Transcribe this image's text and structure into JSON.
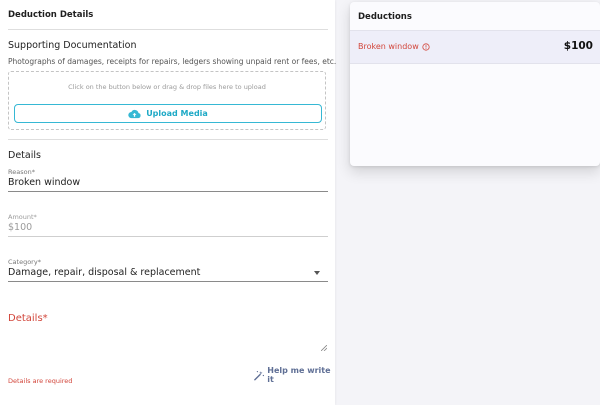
{
  "left_panel": {
    "title": "Deduction Details",
    "supporting": {
      "title": "Supporting Documentation",
      "hint": "Photographs of damages, receipts for repairs, ledgers showing unpaid rent or fees, etc.",
      "drop_hint": "Click on the button below or drag & drop files here to upload",
      "upload_label": "Upload Media",
      "upload_icon": "cloud-upload-icon"
    },
    "details_section_title": "Details",
    "reason": {
      "label": "Reason*",
      "value": "Broken window"
    },
    "amount": {
      "label": "Amount*",
      "prefix": "$",
      "value": "100"
    },
    "category": {
      "label": "Category*",
      "value": "Damage, repair, disposal & replacement"
    },
    "details_field": {
      "label": "Details*",
      "value": "",
      "error": "Details are required"
    },
    "help_write": {
      "label": "Help me write it",
      "icon": "magic-wand-icon"
    }
  },
  "right_panel": {
    "title": "Deductions",
    "items": [
      {
        "reason": "Broken window",
        "amount": "$100",
        "icon": "info-icon"
      }
    ]
  },
  "colors": {
    "accent": "#36b8d4",
    "error": "#d2463b",
    "help_link": "#5f6f95",
    "row_highlight": "#eeeef9"
  }
}
